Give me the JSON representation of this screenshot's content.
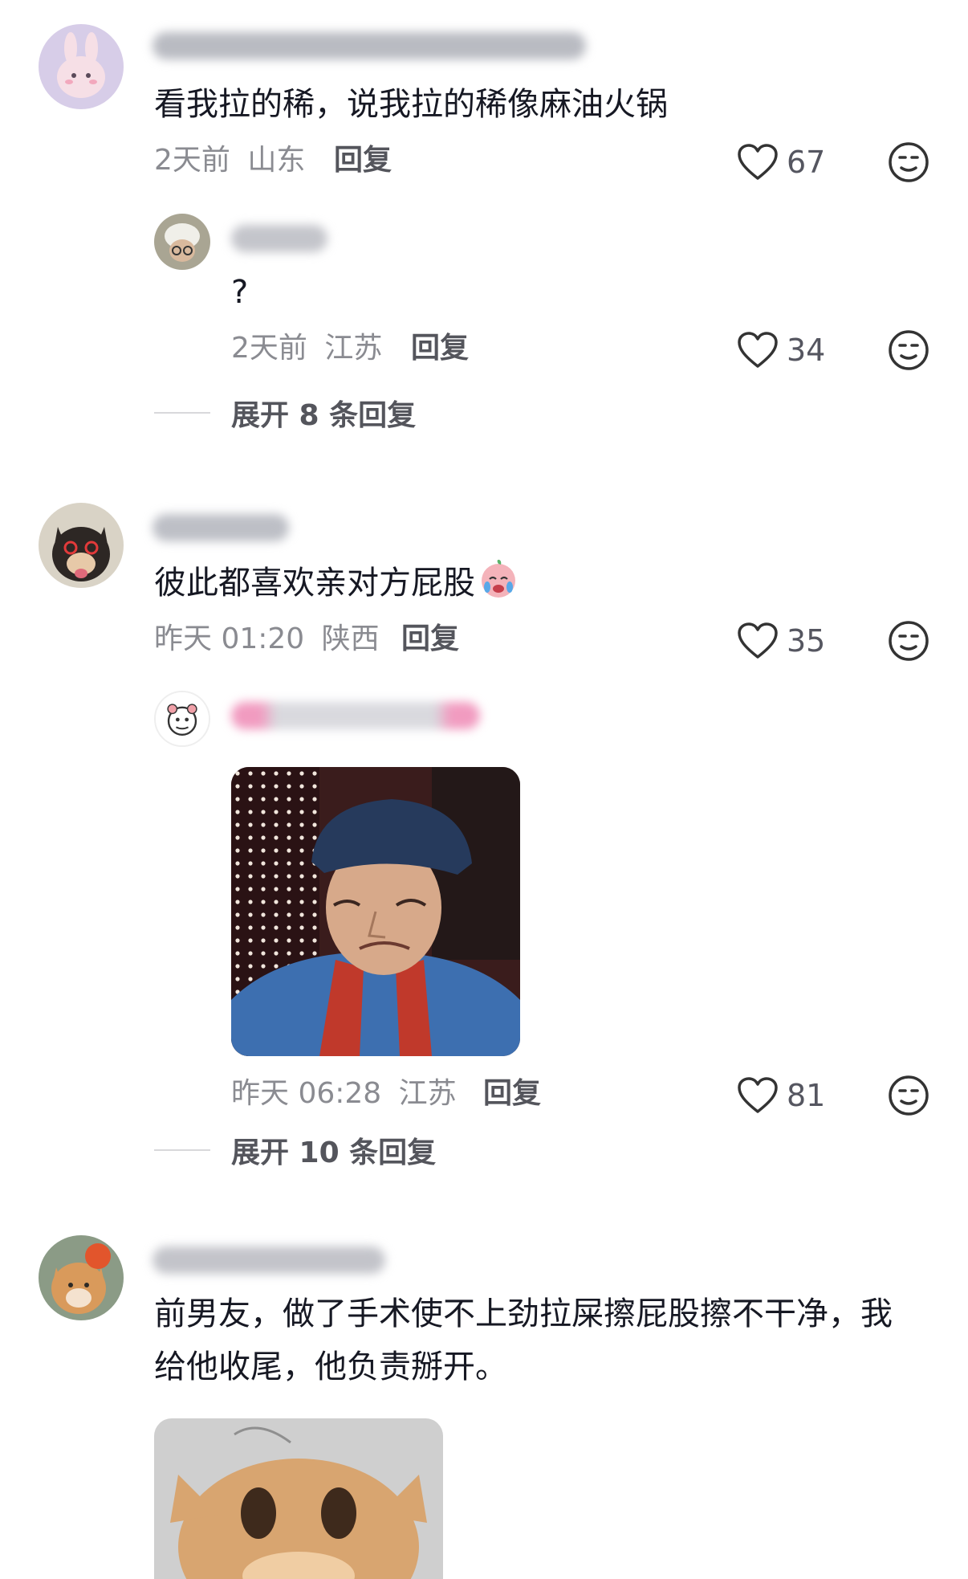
{
  "comments": [
    {
      "text": "看我拉的稀，说我拉的稀像麻油火锅",
      "time": "2天前",
      "location": "山东",
      "reply_label": "回复",
      "likes": "67",
      "replies": [
        {
          "text": "?",
          "time": "2天前",
          "location": "江苏",
          "reply_label": "回复",
          "likes": "34"
        }
      ],
      "expand_label": "展开 8 条回复"
    },
    {
      "text": "彼此都喜欢亲对方屁股",
      "time": "昨天 01:20",
      "location": "陕西",
      "reply_label": "回复",
      "likes": "35",
      "replies": [
        {
          "time": "昨天 06:28",
          "location": "江苏",
          "reply_label": "回复",
          "likes": "81"
        }
      ],
      "expand_label": "展开 10 条回复"
    },
    {
      "text_line1": "前男友，做了手术使不上劲拉屎擦屁股擦不干净，我",
      "text_line2": "给他收尾，他负责掰开。"
    }
  ],
  "icons": {
    "like": "heart-outline-icon",
    "dislike": "neutral-face-icon",
    "emoji": "crying-baby-emoji"
  },
  "colors": {
    "text_primary": "#161823",
    "text_secondary": "#8a8b91",
    "reply_button": "#54555c"
  }
}
